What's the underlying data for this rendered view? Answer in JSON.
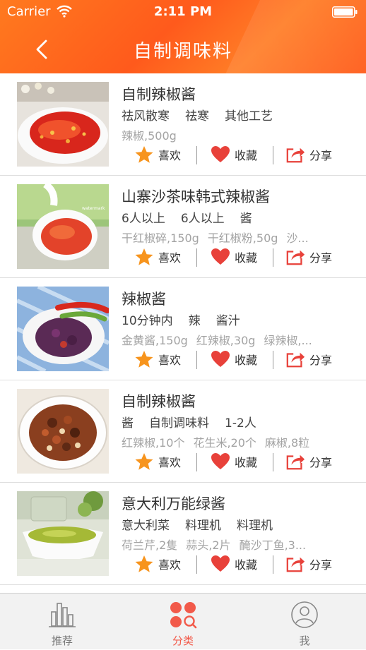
{
  "status_bar": {
    "carrier": "Carrier",
    "time": "2:11 PM"
  },
  "header": {
    "title": "自制调味料",
    "accent_color": "#ff6a1f"
  },
  "actions": {
    "like": "喜欢",
    "favorite": "收藏",
    "share": "分享"
  },
  "items": [
    {
      "title": "自制辣椒酱",
      "tags": [
        "祛风散寒",
        "祛寒",
        "其他工艺"
      ],
      "ingredients": [
        "辣椒,500g"
      ]
    },
    {
      "title": "山寨沙茶味韩式辣椒酱",
      "tags": [
        "6人以上",
        "6人以上",
        "酱"
      ],
      "ingredients": [
        "干红椒碎,150g",
        "干红椒粉,50g",
        "沙..."
      ]
    },
    {
      "title": "辣椒酱",
      "tags": [
        "10分钟内",
        "辣",
        "酱汁"
      ],
      "ingredients": [
        "金黄酱,150g",
        "红辣椒,30g",
        "绿辣椒,..."
      ]
    },
    {
      "title": "自制辣椒酱",
      "tags": [
        "酱",
        "自制调味料",
        "1-2人"
      ],
      "ingredients": [
        "红辣椒,10个",
        "花生米,20个",
        "麻椒,8粒"
      ]
    },
    {
      "title": "意大利万能绿酱",
      "tags": [
        "意大利菜",
        "料理机",
        "料理机"
      ],
      "ingredients": [
        "荷兰芹,2隻",
        "蒜头,2片",
        "醃沙丁鱼,3..."
      ]
    }
  ],
  "tabbar": {
    "tabs": [
      {
        "label": "推荐",
        "icon": "bar-chart-icon"
      },
      {
        "label": "分类",
        "icon": "category-grid-icon",
        "active": true
      },
      {
        "label": "我",
        "icon": "profile-icon"
      }
    ],
    "active_color": "#f25a4a"
  }
}
